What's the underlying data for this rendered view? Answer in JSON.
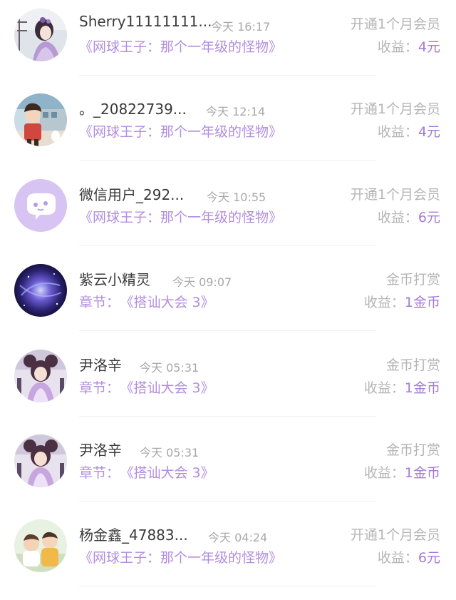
{
  "records": [
    {
      "user": "Sherry11111111...",
      "time": "今天 16:17",
      "work_prefix": "",
      "work": "《网球王子：那个一年级的怪物》",
      "type": "开通1个月会员",
      "earning_label": "收益：",
      "earning_amount": "4元",
      "avatar": "anime-girl-purple-avatar"
    },
    {
      "user": "。_20822739...",
      "time": "今天 12:14",
      "work_prefix": "",
      "work": "《网球王子：那个一年级的怪物》",
      "type": "开通1个月会员",
      "earning_label": "收益：",
      "earning_amount": "4元",
      "avatar": "cartoon-boy-avatar"
    },
    {
      "user": "微信用户_292...",
      "time": "今天 10:55",
      "work_prefix": "",
      "work": "《网球王子：那个一年级的怪物》",
      "type": "开通1个月会员",
      "earning_label": "收益：",
      "earning_amount": "6元",
      "avatar": "chat-bubble-avatar"
    },
    {
      "user": "紫云小精灵",
      "time": "今天 09:07",
      "work_prefix": "章节：",
      "work": "《搭讪大会 3》",
      "type": "金币打赏",
      "earning_label": "收益：",
      "earning_amount": "1金币",
      "avatar": "galaxy-avatar"
    },
    {
      "user": "尹洛辛",
      "time": "今天 05:31",
      "work_prefix": "章节：",
      "work": "《搭讪大会 3》",
      "type": "金币打赏",
      "earning_label": "收益：",
      "earning_amount": "1金币",
      "avatar": "anime-girl-twin-buns-avatar"
    },
    {
      "user": "尹洛辛",
      "time": "今天 05:31",
      "work_prefix": "章节：",
      "work": "《搭讪大会 3》",
      "type": "金币打赏",
      "earning_label": "收益：",
      "earning_amount": "1金币",
      "avatar": "anime-girl-twin-buns-avatar"
    },
    {
      "user": "杨金鑫_47883...",
      "time": "今天 04:24",
      "work_prefix": "",
      "work": "《网球王子：那个一年级的怪物》",
      "type": "开通1个月会员",
      "earning_label": "收益：",
      "earning_amount": "6元",
      "avatar": "two-babies-avatar"
    }
  ],
  "colors": {
    "accent": "#a57ad6",
    "work_text": "#b38de0",
    "muted": "#b5b5b5"
  }
}
